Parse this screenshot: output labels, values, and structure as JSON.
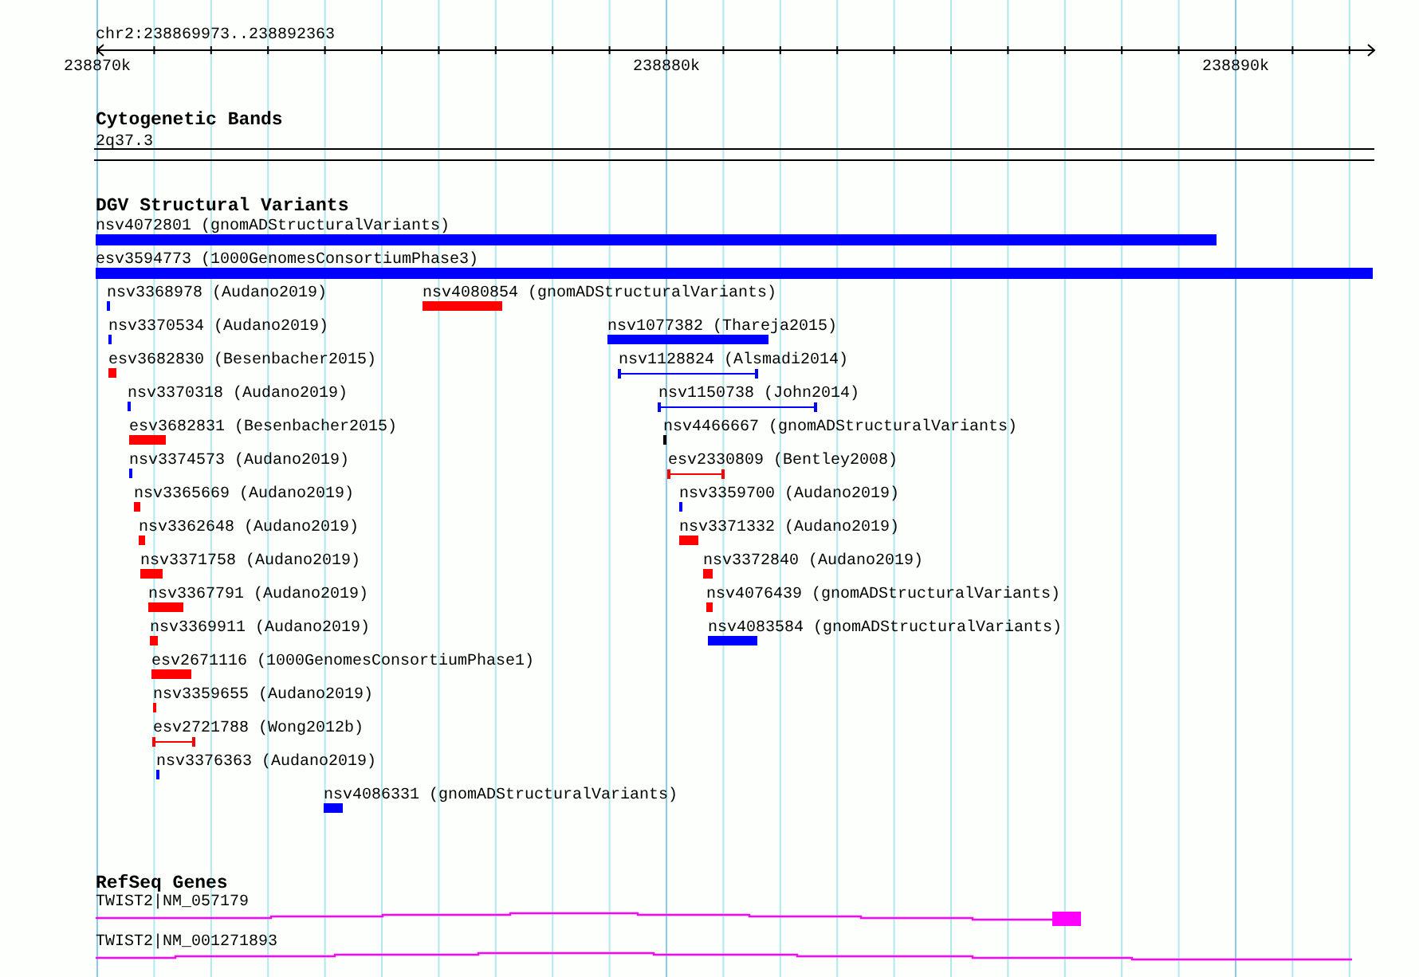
{
  "region": "chr2:238869973..238892363",
  "ruler": {
    "ticks": [
      "238870k",
      "238880k",
      "238890k"
    ]
  },
  "bands": {
    "title": "Cytogenetic Bands",
    "label": "2q37.3"
  },
  "variants": {
    "title": "DGV Structural Variants",
    "features": [
      {
        "name": "nsv4072801 (gnomADStructuralVariants)",
        "kind": "box",
        "color": "#0000ff"
      },
      {
        "name": "esv3594773 (1000GenomesConsortiumPhase3)",
        "kind": "box",
        "color": "#0000ff"
      },
      {
        "name": "nsv3368978 (Audano2019)",
        "kind": "box",
        "color": "#0000ff"
      },
      {
        "name": "nsv4080854 (gnomADStructuralVariants)",
        "kind": "box",
        "color": "#ff0000"
      },
      {
        "name": "nsv3370534 (Audano2019)",
        "kind": "box",
        "color": "#0000ff"
      },
      {
        "name": "nsv1077382 (Thareja2015)",
        "kind": "box",
        "color": "#0000ff"
      },
      {
        "name": "esv3682830 (Besenbacher2015)",
        "kind": "box",
        "color": "#ff0000"
      },
      {
        "name": "nsv1128824 (Alsmadi2014)",
        "kind": "span",
        "color": "#0000ff"
      },
      {
        "name": "nsv3370318 (Audano2019)",
        "kind": "box",
        "color": "#0000ff"
      },
      {
        "name": "nsv1150738 (John2014)",
        "kind": "span",
        "color": "#0000ff"
      },
      {
        "name": "esv3682831 (Besenbacher2015)",
        "kind": "box",
        "color": "#ff0000"
      },
      {
        "name": "nsv4466667 (gnomADStructuralVariants)",
        "kind": "box",
        "color": "#000000"
      },
      {
        "name": "nsv3374573 (Audano2019)",
        "kind": "box",
        "color": "#0000ff"
      },
      {
        "name": "esv2330809 (Bentley2008)",
        "kind": "span",
        "color": "#ff0000"
      },
      {
        "name": "nsv3365669 (Audano2019)",
        "kind": "box",
        "color": "#ff0000"
      },
      {
        "name": "nsv3359700 (Audano2019)",
        "kind": "box",
        "color": "#0000ff"
      },
      {
        "name": "nsv3362648 (Audano2019)",
        "kind": "box",
        "color": "#ff0000"
      },
      {
        "name": "nsv3371332 (Audano2019)",
        "kind": "box",
        "color": "#ff0000"
      },
      {
        "name": "nsv3371758 (Audano2019)",
        "kind": "box",
        "color": "#ff0000"
      },
      {
        "name": "nsv3372840 (Audano2019)",
        "kind": "box",
        "color": "#ff0000"
      },
      {
        "name": "nsv3367791 (Audano2019)",
        "kind": "box",
        "color": "#ff0000"
      },
      {
        "name": "nsv4076439 (gnomADStructuralVariants)",
        "kind": "box",
        "color": "#ff0000"
      },
      {
        "name": "nsv3369911 (Audano2019)",
        "kind": "box",
        "color": "#ff0000"
      },
      {
        "name": "nsv4083584 (gnomADStructuralVariants)",
        "kind": "box",
        "color": "#0000ff"
      },
      {
        "name": "esv2671116 (1000GenomesConsortiumPhase1)",
        "kind": "box",
        "color": "#ff0000"
      },
      {
        "name": "nsv3359655 (Audano2019)",
        "kind": "box",
        "color": "#ff0000"
      },
      {
        "name": "esv2721788 (Wong2012b)",
        "kind": "span",
        "color": "#ff0000"
      },
      {
        "name": "nsv3376363 (Audano2019)",
        "kind": "box",
        "color": "#0000ff"
      },
      {
        "name": "nsv4086331 (gnomADStructuralVariants)",
        "kind": "box",
        "color": "#0000ff"
      }
    ]
  },
  "genes": {
    "title": "RefSeq Genes",
    "items": [
      {
        "name": "TWIST2|NM_057179"
      },
      {
        "name": "TWIST2|NM_001271893"
      }
    ]
  }
}
